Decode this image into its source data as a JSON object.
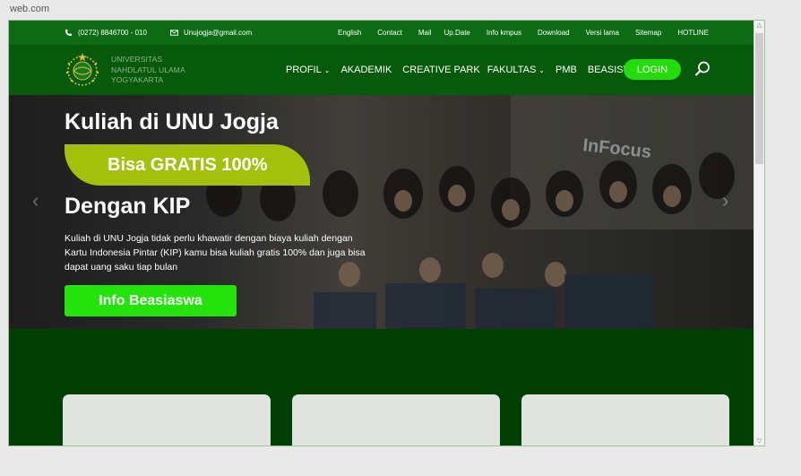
{
  "browser": {
    "url": "web.com"
  },
  "topbar": {
    "phone": "(0272) 8846700 - 010",
    "email": "Unujogja@gmail.com",
    "links": [
      "English",
      "Contact",
      "Mail",
      "Up.Date",
      "Info kmpus",
      "Download",
      "Versi lama",
      "Sitemap",
      "HOTLINE"
    ]
  },
  "brand": {
    "line1": "UNIVERSITAS",
    "line2": "NAHDLATUL ULAMA",
    "line3": "YOGYAKARTA"
  },
  "nav": {
    "profil": "PROFIL",
    "akademik": "AKADEMIK",
    "creative_park": "CREATIVE PARK",
    "fakultas": "FAKULTAS",
    "pmb": "PMB",
    "beasiswa": "BEASISWA",
    "login": "LOGIN"
  },
  "hero": {
    "title": "Kuliah di UNU Jogja",
    "highlight": "Bisa GRATIS 100%",
    "subtitle": "Dengan KIP",
    "description": "Kuliah di UNU Jogja tidak perlu khawatir dengan biaya kuliah dengan Kartu Indonesia Pintar (KIP) kamu bisa kuliah gratis 100% dan juga bisa dapat uang saku tiap bulan",
    "cta": "Info Beasiaswa",
    "photo_text": "InFocus"
  },
  "colors": {
    "topbar": "#0d6b14",
    "navbar": "#075a0c",
    "accent_green": "#22dd0a",
    "highlight": "#a3c10c",
    "lower_bg": "#023f05"
  }
}
